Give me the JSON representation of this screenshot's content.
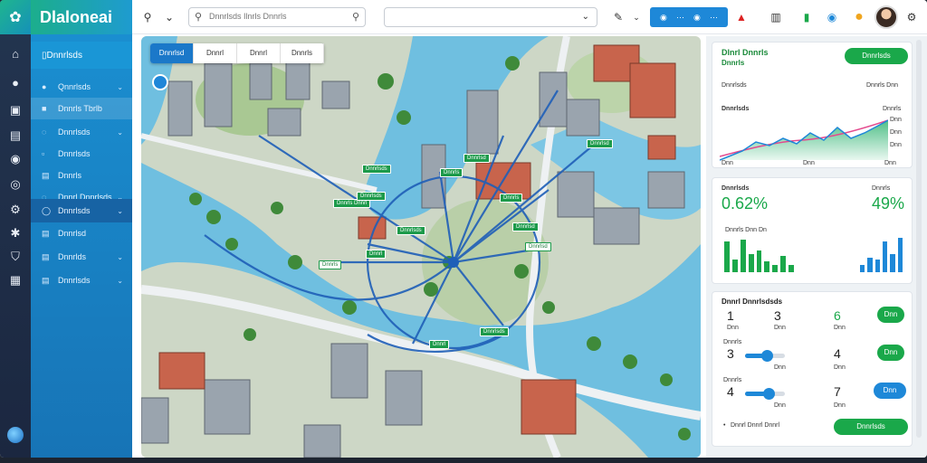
{
  "app": {
    "title": "Dlaloneai",
    "accent": "#1e88d8",
    "brand_gradient": [
      "#1cae8c",
      "#1e9bd0"
    ]
  },
  "rail_icons": [
    "home-icon",
    "pin-icon",
    "inbox-icon",
    "calendar-icon",
    "compass-icon",
    "target-icon",
    "bike-icon",
    "bug-icon",
    "shield-icon",
    "briefcase-icon",
    "globe-icon"
  ],
  "sidebar": {
    "header": "Dnnrlsds",
    "items": [
      {
        "label": "Qnnrlsds",
        "icon": "circle-icon",
        "chevron": true
      },
      {
        "label": "Dnnrls Tbrlb",
        "icon": "square-icon",
        "chevron": false
      },
      {
        "label": "Dnnrlsds",
        "icon": "circle-icon",
        "chevron": true
      },
      {
        "label": "Dnnrlsds",
        "icon": "box-icon",
        "chevron": false
      },
      {
        "label": "Dnnrls",
        "icon": "list-icon",
        "chevron": false
      },
      {
        "label": "Dnnrl Dnnrlsds",
        "icon": "circle-icon",
        "chevron": true
      },
      {
        "label": "Dnnrlsds",
        "icon": "circle-icon",
        "chevron": true
      },
      {
        "label": "Dnnrlsd",
        "icon": "list-icon",
        "chevron": false
      },
      {
        "label": "Dnnrlds",
        "icon": "list-icon",
        "chevron": true
      },
      {
        "label": "Dnnrlsds",
        "icon": "list-icon",
        "chevron": true
      }
    ]
  },
  "topbar": {
    "search_placeholder": "Dnnrlsds Ilnrls Dnnrls",
    "select_value": "",
    "action_button": "",
    "icons": [
      "search-icon",
      "chevron-down-icon",
      "wrench-icon",
      "alert-icon",
      "clipboard-icon",
      "flag-icon",
      "refresh-icon",
      "coin-icon",
      "settings-icon"
    ]
  },
  "map": {
    "tabs": [
      "Dnnrlsd",
      "Dnnrl",
      "Dnnrl",
      "Dnnrls"
    ],
    "active_tab": 0,
    "water_color": "#6fbfe0",
    "land_color": "#cdd7c6",
    "route_color": "#1f5fb8",
    "labels": [
      "Dnnrlsds",
      "Dnnrls Dnnrl",
      "Dnnrlsds",
      "Dnnrls",
      "Dnnrlsd",
      "Dnnrlsd",
      "Dnnrls",
      "Dnnrlsd",
      "Dnnrlsds",
      "Dnnrls",
      "Dnnrl",
      "Dnnrlsds",
      "Dnnrl",
      "Dnnrlsd"
    ]
  },
  "panel": {
    "card1": {
      "title": "Dlnrl Dnnrls",
      "subtitle": "Dnnrls",
      "button": "Dnnrlsds",
      "row_left": "Dnnrlsds",
      "row_right": "Dnnrls Dnn",
      "chart_label": "Dnnrlsds",
      "chart_right": "Dnnrls",
      "axis": [
        "Dnn",
        "Dnn",
        "Dnn"
      ],
      "y_ticks": [
        "Dnn",
        "Dnn",
        "Dnn",
        "Dnn"
      ]
    },
    "card2": {
      "left_label": "Dnnrlsds",
      "right_label": "Dnnrls",
      "left_value": "0.62%",
      "right_value": "49%",
      "bars_label": "Dnnrls Dnn Dn",
      "bars_left": [
        0.85,
        0.35,
        0.9,
        0.5,
        0.6,
        0.3,
        0.2,
        0.45,
        0.2
      ],
      "bars_right": [
        0.2,
        0.4,
        0.35,
        0.85,
        0.5,
        0.95
      ],
      "green": "#1aa84a",
      "blue": "#1e88d8"
    },
    "card3": {
      "title": "Dnnrl Dnnrlsdsds",
      "rows": [
        {
          "a": "1",
          "b": "3",
          "c": "6",
          "la": "Dnn",
          "lb": "Dnn",
          "lc": "Dnn",
          "btn": "Dnn",
          "btn_color": "green"
        },
        {
          "a": "3",
          "b": "",
          "c": "4",
          "la": "Dnnrls",
          "lb": "Dnn",
          "lc": "Dnn",
          "btn": "Dnn",
          "btn_color": "green",
          "slider": 0.55
        },
        {
          "a": "4",
          "b": "",
          "c": "7",
          "la": "Dnnrls",
          "lb": "Dnn",
          "lc": "Dnn",
          "btn": "Dnn",
          "btn_color": "blue",
          "slider": 0.6
        }
      ],
      "footer_label": "Dnnrl Dnnrl Dnnrl",
      "footer_button": "Dnnrlsds"
    }
  }
}
